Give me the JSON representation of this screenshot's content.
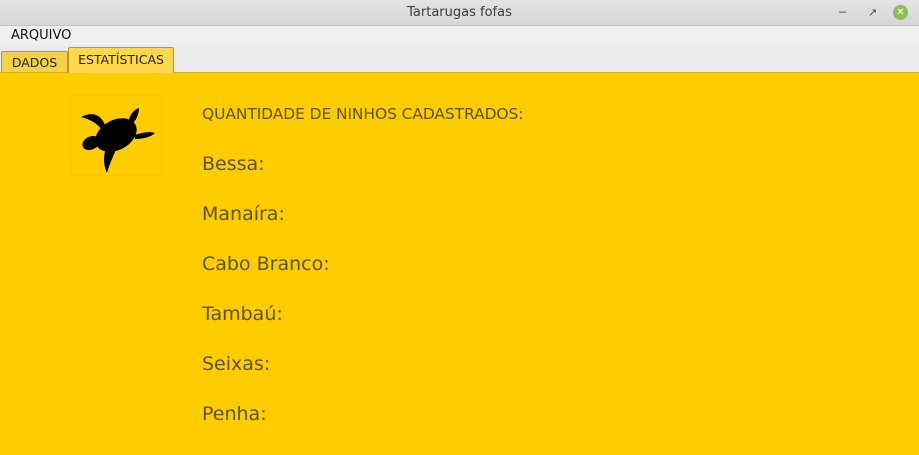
{
  "window": {
    "title": "Tartarugas fofas"
  },
  "menubar": {
    "items": [
      {
        "label": "ARQUIVO"
      }
    ]
  },
  "tabs": [
    {
      "label": "DADOS",
      "active": false
    },
    {
      "label": "ESTATÍSTICAS",
      "active": true
    }
  ],
  "stats": {
    "heading": "QUANTIDADE DE NINHOS CADASTRADOS:",
    "beaches": [
      {
        "label": "Bessa:"
      },
      {
        "label": "Manaíra:"
      },
      {
        "label": "Cabo Branco:"
      },
      {
        "label": "Tambaú:"
      },
      {
        "label": "Seixas:"
      },
      {
        "label": "Penha:"
      }
    ]
  },
  "colors": {
    "background": "#ffcc00",
    "text": "#5c5326",
    "close_button": "#8fbc5a"
  },
  "icons": {
    "logo": "turtle-icon",
    "minimize": "minimize-icon",
    "maximize": "maximize-icon",
    "close": "close-icon"
  }
}
